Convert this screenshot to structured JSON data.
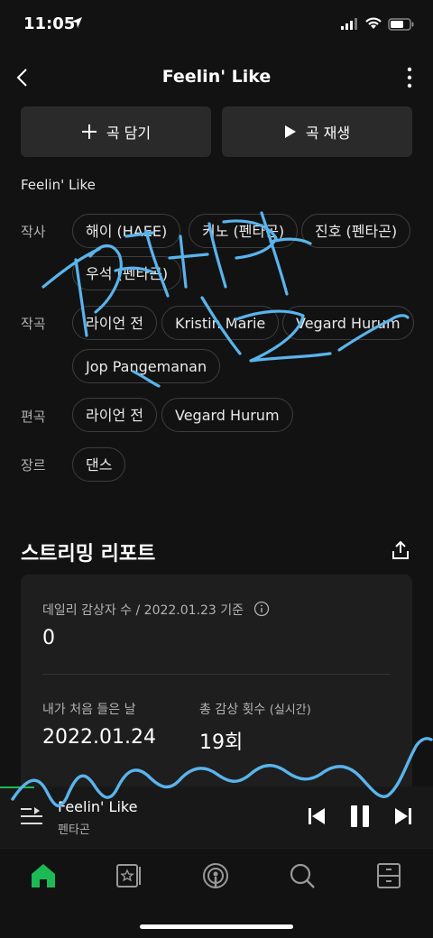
{
  "status_bar": {
    "time": "11:05"
  },
  "header": {
    "title": "Feelin' Like"
  },
  "actions": {
    "add_label": "곡 담기",
    "play_label": "곡 재생"
  },
  "song": {
    "name": "Feelin' Like"
  },
  "credits": {
    "lyricist_label": "작사",
    "lyricists": [
      "해이 (HAEE)",
      "키노 (펜타곤)",
      "진호 (펜타곤)",
      "우석 (펜타곤)"
    ],
    "composer_label": "작곡",
    "composers": [
      "라이언 전",
      "Kristin Marie",
      "Vegard Hurum",
      "Jop Pangemanan"
    ],
    "arranger_label": "편곡",
    "arrangers": [
      "라이언 전",
      "Vegard Hurum"
    ],
    "genre_label": "장르",
    "genres": [
      "댄스"
    ]
  },
  "report": {
    "title": "스트리밍 리포트",
    "daily_label": "데일리 감상자 수 / 2022.01.23 기준",
    "daily_value": "0",
    "first_label": "내가 처음 들은 날",
    "first_value": "2022.01.24",
    "total_label": "총 감상 횟수",
    "total_sub": "(실시간)",
    "total_value": "19회"
  },
  "mini_player": {
    "title": "Feelin' Like",
    "artist": "펜타곤",
    "progress": 0.08
  },
  "tabs": [
    "home-icon",
    "library-icon",
    "podcast-icon",
    "search-icon",
    "storage-icon"
  ],
  "colors": {
    "accent": "#1db954",
    "background": "#121212",
    "scribble": "#5ab4ec"
  }
}
